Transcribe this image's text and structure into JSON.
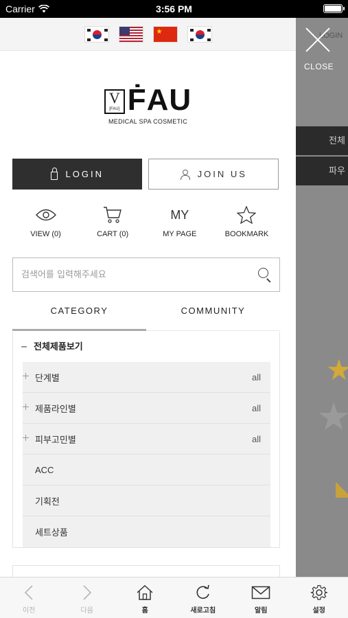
{
  "status_bar": {
    "carrier": "Carrier",
    "time": "3:56 PM"
  },
  "language_flags": [
    "korea-flag-icon",
    "usa-flag-icon",
    "china-flag-icon",
    "korea-flag-icon"
  ],
  "logo": {
    "box_letter": "V",
    "box_sub": "[FAU]",
    "brand": "ḞAU",
    "tagline": "MEDICAL SPA COSMETIC"
  },
  "auth": {
    "login_label": "LOGIN",
    "join_label": "JOIN US"
  },
  "quick_links": [
    {
      "icon": "eye-icon",
      "label": "VIEW (0)"
    },
    {
      "icon": "cart-icon",
      "label": "CART (0)"
    },
    {
      "icon": "my-text-icon",
      "icon_text": "MY",
      "label": "MY PAGE"
    },
    {
      "icon": "star-icon",
      "label": "BOOKMARK"
    }
  ],
  "search": {
    "placeholder": "검색어를 입력해주세요"
  },
  "tabs": [
    {
      "label": "CATEGORY",
      "active": true
    },
    {
      "label": "COMMUNITY",
      "active": false
    }
  ],
  "category": {
    "root": "전체제품보기",
    "items": [
      {
        "label": "단계별",
        "expandable": true,
        "count": "all"
      },
      {
        "label": "제품라인별",
        "expandable": true,
        "count": "all"
      },
      {
        "label": "피부고민별",
        "expandable": true,
        "count": "all"
      },
      {
        "label": "ACC",
        "expandable": false,
        "count": ""
      },
      {
        "label": "기획전",
        "expandable": false,
        "count": ""
      },
      {
        "label": "세트상품",
        "expandable": false,
        "count": ""
      }
    ]
  },
  "overlay": {
    "close_label": "CLOSE",
    "login_ghost": "LOGIN",
    "row1": "전체",
    "row2": "파우"
  },
  "toolbar": [
    {
      "icon": "chevron-left-icon",
      "label": "이전",
      "enabled": false
    },
    {
      "icon": "chevron-right-icon",
      "label": "다음",
      "enabled": false
    },
    {
      "icon": "home-icon",
      "label": "홈",
      "enabled": true
    },
    {
      "icon": "refresh-icon",
      "label": "새로고침",
      "enabled": true
    },
    {
      "icon": "mail-icon",
      "label": "알림",
      "enabled": true
    },
    {
      "icon": "gear-icon",
      "label": "설정",
      "enabled": true
    }
  ],
  "colors": {
    "login_bg": "#2f2f2f",
    "overlay_bg": "#8a8a8a",
    "star_gold": "#d4a93a"
  }
}
